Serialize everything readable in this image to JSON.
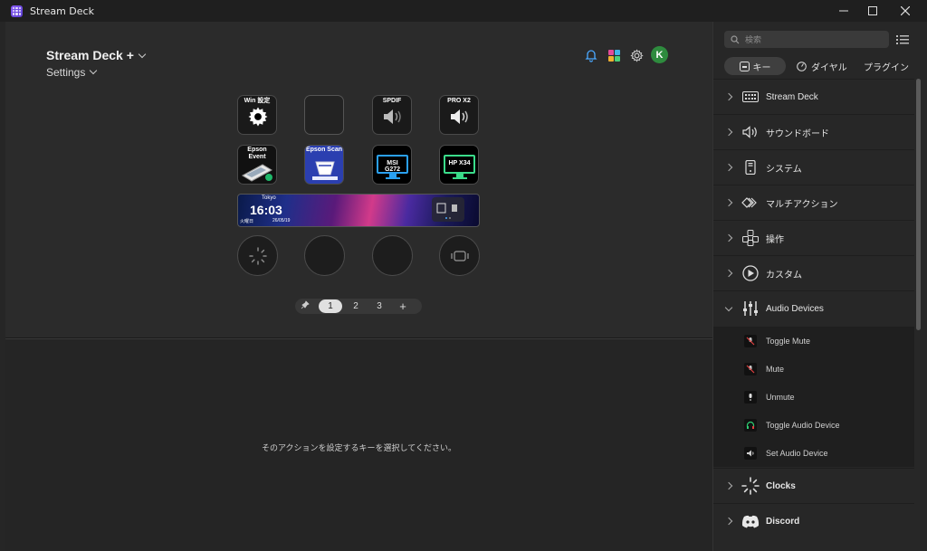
{
  "window": {
    "title": "Stream Deck"
  },
  "device": {
    "name": "Stream Deck +",
    "settings_label": "Settings"
  },
  "profile": {
    "avatar_initial": "K"
  },
  "keys": [
    {
      "label": "Win 設定",
      "icon": "gear-icon"
    },
    {
      "label": "",
      "icon": ""
    },
    {
      "label": "SPDIF",
      "icon": "speaker-icon"
    },
    {
      "label": "PRO X2",
      "icon": "speaker-icon"
    },
    {
      "label": "Epson Event",
      "icon": "scanner-icon"
    },
    {
      "label": "Epson Scan",
      "icon": "scanner-icon"
    },
    {
      "label": "MSI G272",
      "icon": "monitor-icon"
    },
    {
      "label": "HP X34",
      "icon": "monitor-icon"
    }
  ],
  "touch_strip": {
    "city": "Tokyo",
    "time": "16:03",
    "day": "火曜日",
    "date": "26/05/19"
  },
  "pager": {
    "pages": [
      "1",
      "2",
      "3"
    ],
    "active": "1",
    "add_label": "+"
  },
  "bottom": {
    "message": "そのアクションを設定するキーを選択してください。"
  },
  "sidebar": {
    "search_placeholder": "検索",
    "tabs": {
      "keys": "キー",
      "dial": "ダイヤル",
      "plugins": "プラグイン"
    },
    "categories": [
      {
        "label": "Stream Deck",
        "icon": "keypad-icon"
      },
      {
        "label": "サウンドボード",
        "icon": "speaker-icon"
      },
      {
        "label": "システム",
        "icon": "computer-tower-icon"
      },
      {
        "label": "マルチアクション",
        "icon": "multi-action-icon"
      },
      {
        "label": "操作",
        "icon": "control-icon"
      },
      {
        "label": "カスタム",
        "icon": "custom-icon"
      },
      {
        "label": "Audio Devices",
        "icon": "sliders-icon"
      },
      {
        "label": "Clocks",
        "icon": "clock-icon"
      },
      {
        "label": "Discord",
        "icon": "discord-icon"
      }
    ],
    "audio_actions": [
      {
        "label": "Toggle Mute",
        "icon": "mic-mute-icon"
      },
      {
        "label": "Mute",
        "icon": "mic-mute-icon"
      },
      {
        "label": "Unmute",
        "icon": "mic-icon"
      },
      {
        "label": "Toggle Audio Device",
        "icon": "headset-icon"
      },
      {
        "label": "Set Audio Device",
        "icon": "speaker-icon"
      }
    ]
  },
  "colors": {
    "avatar": "#2e8b3e",
    "accent_purple": "#8a5cf6",
    "monitor_blue": "#2aa0f0",
    "monitor_green": "#3adc8a"
  }
}
